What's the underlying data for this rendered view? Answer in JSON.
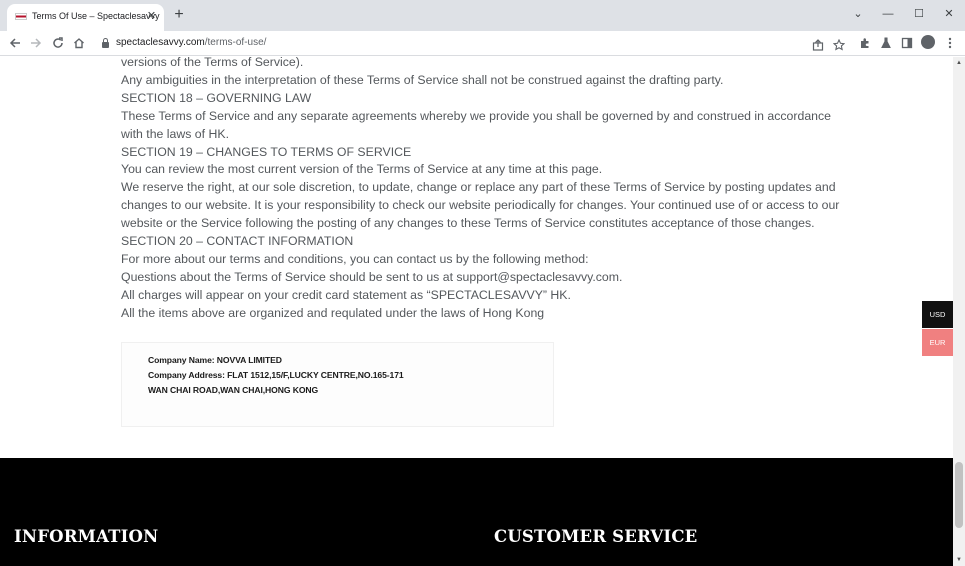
{
  "browser": {
    "tab_title": "Terms Of Use – Spectaclesavvy",
    "tab_close": "✕",
    "new_tab": "+",
    "url_host": "spectaclesavvy.com",
    "url_path": "/terms-of-use/",
    "icons": {
      "back": "arrow-left-icon",
      "forward": "arrow-right-icon",
      "reload": "reload-icon",
      "home": "home-icon",
      "share": "share-icon",
      "bookmark": "star-icon",
      "extensions": "puzzle-icon",
      "labs": "flask-icon",
      "sidepanel": "side-panel-icon",
      "profile": "profile-icon",
      "menu": "kebab-menu-icon"
    },
    "window_controls": {
      "tabsearch": "⌄",
      "minimize": "—",
      "maximize": "☐",
      "close": "✕"
    }
  },
  "terms": {
    "lines": [
      {
        "text": "versions of the Terms of Service).",
        "type": "body"
      },
      {
        "text": "Any ambiguities in the interpretation of these Terms of Service shall not be construed against the drafting party.",
        "type": "body"
      },
      {
        "text": "SECTION 18 – GOVERNING LAW",
        "type": "heading"
      },
      {
        "text": "These Terms of Service and any separate agreements whereby we provide you shall be governed by and construed in accordance",
        "type": "body"
      },
      {
        "text": "with the laws of HK.",
        "type": "body"
      },
      {
        "text": "SECTION 19 – CHANGES TO TERMS OF SERVICE",
        "type": "heading"
      },
      {
        "text": "You can review the most current version of the Terms of Service at any time at this page.",
        "type": "body"
      },
      {
        "text": "We reserve the right, at our sole discretion, to update, change or replace any part of these Terms of Service by posting updates and",
        "type": "body"
      },
      {
        "text": "changes to our website. It is your responsibility to check our website periodically for changes. Your continued use of or access to our",
        "type": "body"
      },
      {
        "text": "website or the Service following the posting of any changes to these Terms of Service constitutes acceptance of those changes.",
        "type": "body"
      },
      {
        "text": "SECTION 20 – CONTACT INFORMATION",
        "type": "heading"
      },
      {
        "text": "For more about our terms and conditions, you can contact us by the following method:",
        "type": "body"
      },
      {
        "text": "Questions about the Terms of Service should be sent to us at support@spectaclesavvy.com.",
        "type": "body"
      },
      {
        "text": "All charges will appear on your credit card statement as “SPECTACLESAVVY” HK.",
        "type": "body"
      },
      {
        "text": "All the items above are organized and requlated under the laws of Hong Kong",
        "type": "body"
      }
    ]
  },
  "company": {
    "name_line": "Company Name: NOVVA LIMITED",
    "address_line1": "Company Address: FLAT 1512,15/F,LUCKY CENTRE,NO.165-171",
    "address_line2": "WAN CHAI ROAD,WAN CHAI,HONG KONG"
  },
  "currency": {
    "usd": "USD",
    "eur": "EUR",
    "usd_color": "#111111",
    "eur_color": "#f08080"
  },
  "footer": {
    "information_heading": "INFORMATION",
    "customer_service_heading": "CUSTOMER SERVICE"
  }
}
